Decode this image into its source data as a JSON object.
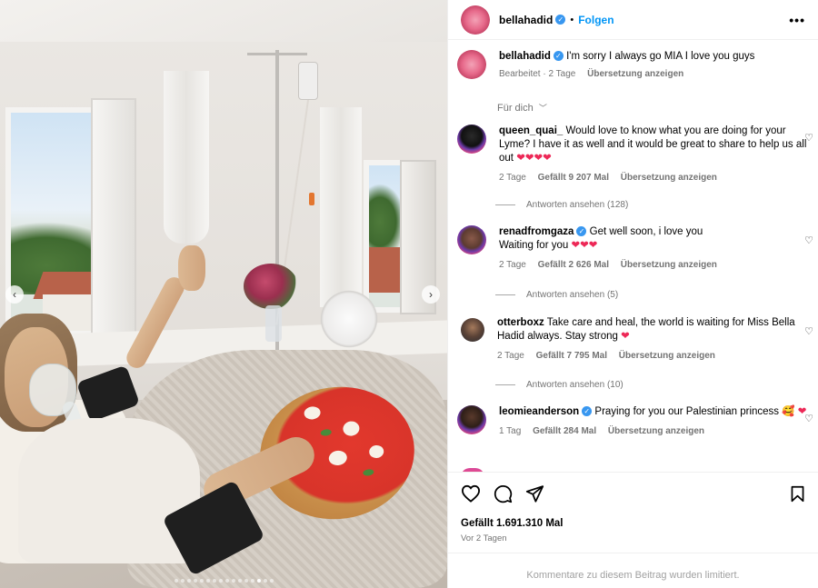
{
  "post": {
    "username": "bellahadid",
    "follow_label": "Folgen",
    "more_label": "•••",
    "caption": "I'm sorry I always go MIA I love you guys",
    "caption_edited": "Bearbeitet",
    "caption_age": "2 Tage",
    "translate_label": "Übersetzung anzeigen",
    "sort_label": "Für dich",
    "likes": "Gefällt 1.691.310 Mal",
    "posted": "Vor 2 Tagen",
    "comments_limited": "Kommentare zu diesem Beitrag wurden limitiert.",
    "carousel_dots": 16,
    "carousel_active_index": 13
  },
  "comments": [
    {
      "username": "queen_quai_",
      "verified": false,
      "text": "Would love to know what you are doing for your Lyme? I have it as well and it would be great to share to help us all out",
      "emoji": "❤❤❤❤",
      "age": "2 Tage",
      "likes": "Gefällt 9 207 Mal",
      "translate": "Übersetzung anzeigen",
      "replies": "Antworten ansehen (128)"
    },
    {
      "username": "renadfromgaza",
      "verified": true,
      "text": "Get well soon, i love you",
      "text2": "Waiting for you",
      "emoji": "❤❤❤",
      "age": "2 Tage",
      "likes": "Gefällt 2 626 Mal",
      "translate": "Übersetzung anzeigen",
      "replies": "Antworten ansehen (5)"
    },
    {
      "username": "otterboxz",
      "verified": false,
      "text": "Take care and heal, the world is waiting for Miss Bella Hadid always. Stay strong",
      "emoji": "❤",
      "age": "2 Tage",
      "likes": "Gefällt 7 795 Mal",
      "translate": "Übersetzung anzeigen",
      "replies": "Antworten ansehen (10)"
    },
    {
      "username": "leomieanderson",
      "verified": true,
      "text": "Praying for you our Palestinian princess",
      "emoji": "🥰",
      "emoji2": "❤",
      "age": "1 Tag",
      "likes": "Gefällt 284 Mal",
      "translate": "Übersetzung anzeigen"
    }
  ],
  "icons": {
    "heart": "heart-icon",
    "comment": "comment-icon",
    "share": "share-icon",
    "save": "bookmark-icon",
    "verified": "verified-badge-icon",
    "chevron": "chevron-down-icon"
  },
  "colors": {
    "link": "#0095f6",
    "verified": "#3897f0",
    "heart_emoji": "#ed2857",
    "meta": "#737373"
  }
}
